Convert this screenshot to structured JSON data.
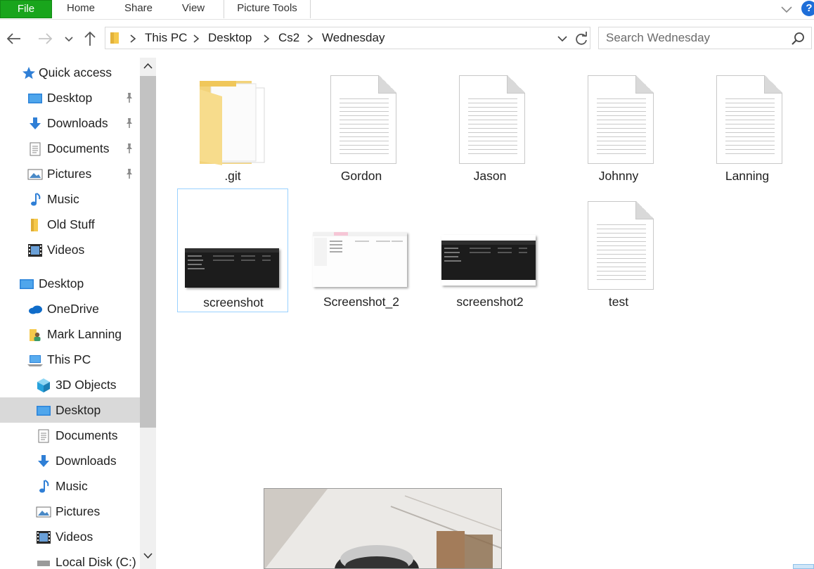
{
  "ribbon": {
    "tabs": [
      "File",
      "Home",
      "Share",
      "View",
      "Picture Tools"
    ],
    "help_label": "?"
  },
  "nav": {
    "breadcrumb": [
      "This PC",
      "Desktop",
      "Cs2",
      "Wednesday"
    ],
    "search_placeholder": "Search Wednesday"
  },
  "sidebar": {
    "items": [
      {
        "label": "Quick access",
        "icon": "star-icon",
        "pinned": false
      },
      {
        "label": "Desktop",
        "icon": "desktop-icon",
        "pinned": true
      },
      {
        "label": "Downloads",
        "icon": "download-icon",
        "pinned": true
      },
      {
        "label": "Documents",
        "icon": "document-icon",
        "pinned": true
      },
      {
        "label": "Pictures",
        "icon": "pictures-icon",
        "pinned": true
      },
      {
        "label": "Music",
        "icon": "music-icon",
        "pinned": false
      },
      {
        "label": "Old Stuff",
        "icon": "folder-icon",
        "pinned": false
      },
      {
        "label": "Videos",
        "icon": "videos-icon",
        "pinned": false
      },
      {
        "label": "Desktop",
        "icon": "desktop-icon",
        "pinned": false
      },
      {
        "label": "OneDrive",
        "icon": "cloud-icon",
        "pinned": false
      },
      {
        "label": "Mark Lanning",
        "icon": "user-folder-icon",
        "pinned": false
      },
      {
        "label": "This PC",
        "icon": "computer-icon",
        "pinned": false
      },
      {
        "label": "3D Objects",
        "icon": "cube-icon",
        "pinned": false
      },
      {
        "label": "Desktop",
        "icon": "desktop-icon",
        "pinned": false
      },
      {
        "label": "Documents",
        "icon": "document-icon",
        "pinned": false
      },
      {
        "label": "Downloads",
        "icon": "download-icon",
        "pinned": false
      },
      {
        "label": "Music",
        "icon": "music-icon",
        "pinned": false
      },
      {
        "label": "Pictures",
        "icon": "pictures-icon",
        "pinned": false
      },
      {
        "label": "Videos",
        "icon": "videos-icon",
        "pinned": false
      },
      {
        "label": "Local Disk (C:)",
        "icon": "disk-icon",
        "pinned": false
      }
    ],
    "selected_index": 13
  },
  "files": [
    {
      "name": ".git",
      "kind": "folder"
    },
    {
      "name": "Gordon",
      "kind": "text"
    },
    {
      "name": "Jason",
      "kind": "text"
    },
    {
      "name": "Johnny",
      "kind": "text"
    },
    {
      "name": "Lanning",
      "kind": "text"
    },
    {
      "name": "screenshot",
      "kind": "image-dark",
      "selected": true
    },
    {
      "name": "Screenshot_2",
      "kind": "image-light"
    },
    {
      "name": "screenshot2",
      "kind": "image-dark"
    },
    {
      "name": "test",
      "kind": "text"
    }
  ],
  "colors": {
    "file_tab": "#19a51c",
    "accent_blue": "#1e6ed8",
    "selection_border": "#99d1ff"
  }
}
